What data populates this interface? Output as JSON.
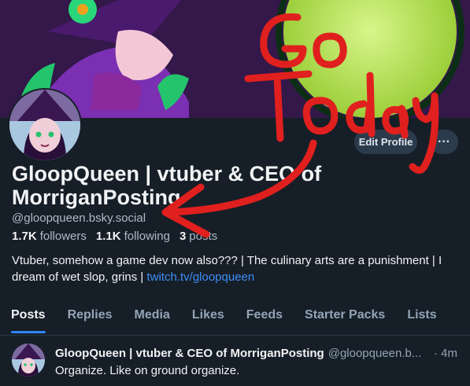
{
  "profile": {
    "display_name": "GloopQueen | vtuber & CEO of MorriganPosting",
    "handle": "@gloopqueen.bsky.social",
    "followers_count": "1.7K",
    "followers_label": "followers",
    "following_count": "1.1K",
    "following_label": "following",
    "posts_count": "3",
    "posts_label": "posts",
    "bio_text": "Vtuber, somehow a game dev now also??? | The culinary arts are a punishment | I dream of wet slop, grins | ",
    "bio_link": "twitch.tv/gloopqueen"
  },
  "actions": {
    "edit_label": "Edit Profile",
    "more_label": "···"
  },
  "tabs": [
    {
      "label": "Posts",
      "active": true
    },
    {
      "label": "Replies"
    },
    {
      "label": "Media"
    },
    {
      "label": "Likes"
    },
    {
      "label": "Feeds"
    },
    {
      "label": "Starter Packs"
    },
    {
      "label": "Lists"
    }
  ],
  "post": {
    "author": "GloopQueen | vtuber & CEO of MorriganPosting",
    "handle": "@gloopqueen.b...",
    "time": "· 4m",
    "text": "Organize. Like on ground organize."
  },
  "annotation": {
    "text": "Go Today",
    "color": "#e0201e"
  },
  "colors": {
    "background": "#161e27",
    "accent": "#2f86f6",
    "link": "#3f8ef5",
    "muted": "#93a5b7"
  }
}
